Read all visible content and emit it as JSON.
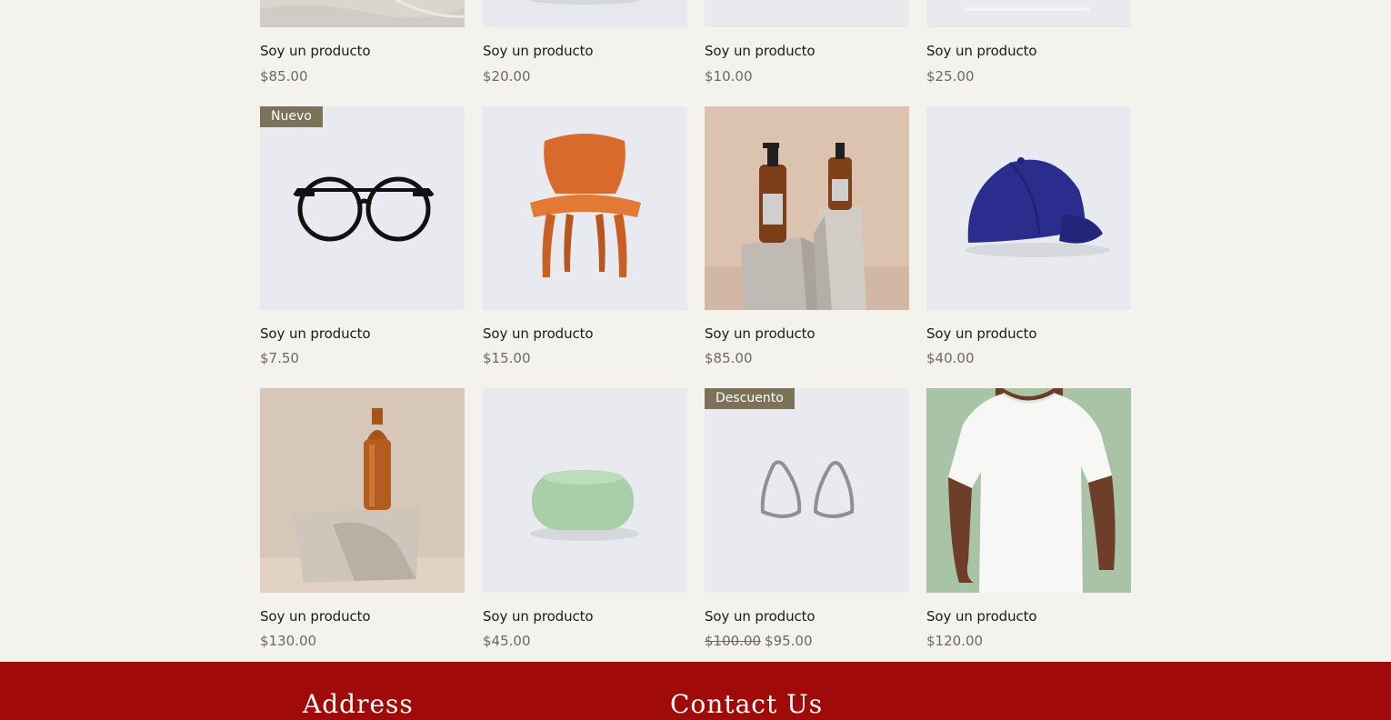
{
  "products": [
    {
      "name": "Soy un producto",
      "price": "$85.00",
      "image": "sand-texture"
    },
    {
      "name": "Soy un producto",
      "price": "$20.00",
      "image": "product-photo-grey"
    },
    {
      "name": "Soy un producto",
      "price": "$10.00",
      "image": "product-photo-grey"
    },
    {
      "name": "Soy un producto",
      "price": "$25.00",
      "image": "product-photo-grey"
    },
    {
      "name": "Soy un producto",
      "price": "$7.50",
      "ribbon": "Nuevo",
      "image": "eyeglasses"
    },
    {
      "name": "Soy un producto",
      "price": "$15.00",
      "image": "wooden-chair"
    },
    {
      "name": "Soy un producto",
      "price": "$85.00",
      "image": "amber-bottles-on-stone"
    },
    {
      "name": "Soy un producto",
      "price": "$40.00",
      "image": "blue-baseball-cap"
    },
    {
      "name": "Soy un producto",
      "price": "$130.00",
      "image": "copper-water-bottle"
    },
    {
      "name": "Soy un producto",
      "price": "$45.00",
      "image": "green-soap"
    },
    {
      "name": "Soy un producto",
      "old_price": "$100.00",
      "price": "$95.00",
      "ribbon": "Descuento",
      "image": "silver-earrings"
    },
    {
      "name": "Soy un producto",
      "price": "$120.00",
      "image": "white-t-shirt-model"
    }
  ],
  "footer": {
    "address_heading": "Address",
    "contact_heading": "Contact Us",
    "background": "#a00b09"
  },
  "colors": {
    "page_background": "#f4f2ec",
    "ribbon_background": "#7b7259",
    "price_text": "#6e6a62"
  }
}
